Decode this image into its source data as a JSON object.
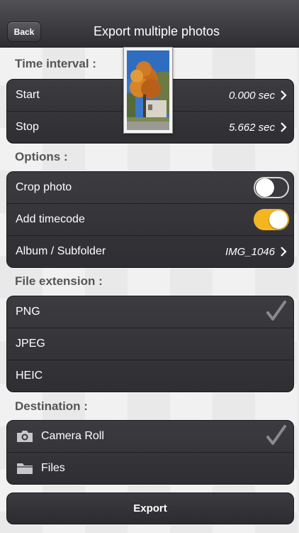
{
  "nav": {
    "back_label": "Back",
    "title": "Export multiple photos"
  },
  "time_interval": {
    "header": "Time interval :",
    "start_label": "Start",
    "start_value": "0.000 sec",
    "stop_label": "Stop",
    "stop_value": "5.662 sec"
  },
  "options": {
    "header": "Options :",
    "crop_label": "Crop photo",
    "crop_on": false,
    "timecode_label": "Add timecode",
    "timecode_on": true,
    "album_label": "Album / Subfolder",
    "album_value": "IMG_1046"
  },
  "file_extension": {
    "header": "File extension :",
    "items": [
      {
        "label": "PNG",
        "selected": true
      },
      {
        "label": "JPEG",
        "selected": false
      },
      {
        "label": "HEIC",
        "selected": false
      }
    ]
  },
  "destination": {
    "header": "Destination :",
    "items": [
      {
        "label": "Camera Roll",
        "icon": "camera-icon",
        "selected": true
      },
      {
        "label": "Files",
        "icon": "folder-icon",
        "selected": false
      }
    ]
  },
  "export_label": "Export",
  "colors": {
    "accent": "#f4b521",
    "cell_bg": "#333337",
    "navbar": "#3a3a3e"
  }
}
